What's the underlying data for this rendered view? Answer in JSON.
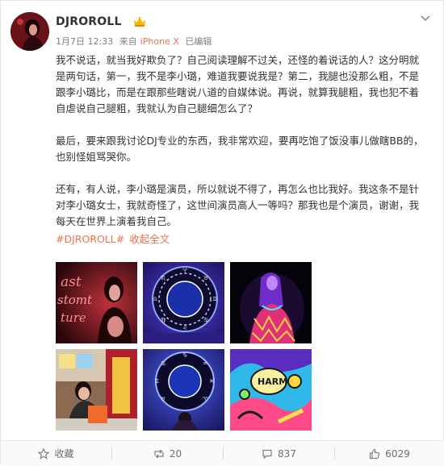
{
  "post": {
    "author": "DJROROLL",
    "date": "1月7日 12:33",
    "source_prefix": "来自",
    "source": "iPhone X",
    "edited": "已编辑",
    "paragraphs": [
      "我不说话，就当我好欺负了？自己阅读理解不过关，还怪的着说话的人？这分明就是两句话，第一，我不是李小璐，难道我要说我是？第二，我腿也没那么粗，不是跟李小璐比，而是在跟那些瞎说八道的自媒体说。再说，就算我腿粗，我也犯不着自虐说自己腿粗，我就认为自己腿细怎么了？",
      "最后，要来跟我讨论DJ专业的东西，我非常欢迎，要再吃饱了饭没事儿做瞎BB的，也别怪姐骂哭你。",
      "还有，有人说，李小璐是演员，所以就说不得了，再怎么也比我好。我这条不是针对李小璐女士，我就奇怪了，这世间演员高人一等吗？那我也是个演员，谢谢，我每天在世界上演着我自己。"
    ],
    "hashtag": "#DJROROLL#",
    "collapse_label": "收起全文"
  },
  "images": [
    {
      "name": "photo-neon-sign",
      "text": "ast\nstomt\nture"
    },
    {
      "name": "photo-zodiac-wheel-1"
    },
    {
      "name": "photo-neon-woman"
    },
    {
      "name": "photo-shop-woman"
    },
    {
      "name": "photo-zodiac-wheel-2"
    },
    {
      "name": "photo-mural-harm",
      "text": "HARM"
    }
  ],
  "footer": {
    "favorite_label": "收藏",
    "repost_count": "20",
    "comment_count": "837",
    "like_count": "6029"
  },
  "colors": {
    "link": "#eb7350",
    "text": "#333333",
    "meta": "#808080"
  }
}
